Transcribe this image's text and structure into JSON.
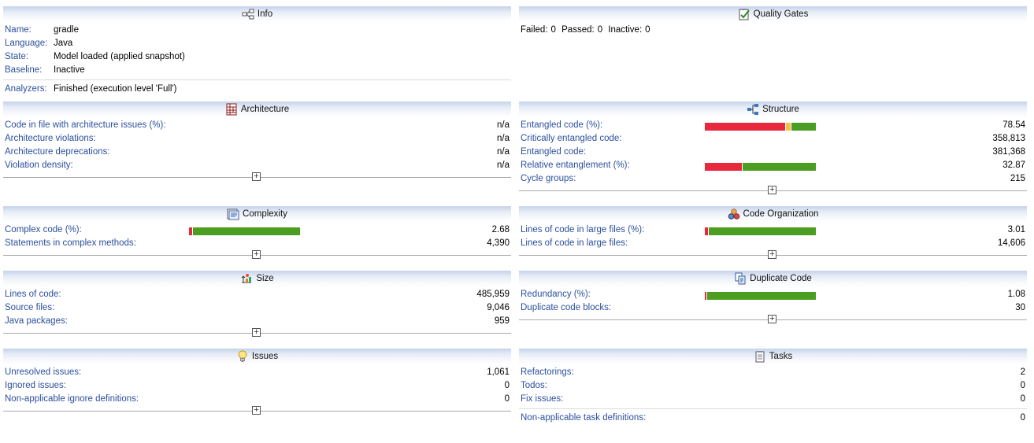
{
  "info": {
    "title": "Info",
    "icon": "info-diagram-icon",
    "rows": [
      {
        "label": "Name:",
        "value": "gradle"
      },
      {
        "label": "Language:",
        "value": "Java"
      },
      {
        "label": "State:",
        "value": "Model loaded (applied snapshot)"
      },
      {
        "label": "Baseline:",
        "value": "Inactive"
      }
    ],
    "analyzers": {
      "label": "Analyzers:",
      "value": "Finished (execution level 'Full')"
    }
  },
  "quality_gates": {
    "title": "Quality Gates",
    "icon": "checklist-icon",
    "failed_label": "Failed:",
    "failed": "0",
    "passed_label": "Passed:",
    "passed": "0",
    "inactive_label": "Inactive:",
    "inactive": "0"
  },
  "architecture": {
    "title": "Architecture",
    "icon": "architecture-icon",
    "rows": [
      {
        "label": "Code in file with architecture issues (%):",
        "value": "n/a"
      },
      {
        "label": "Architecture violations:",
        "value": "n/a"
      },
      {
        "label": "Architecture deprecations:",
        "value": "n/a"
      },
      {
        "label": "Violation density:",
        "value": "n/a"
      }
    ]
  },
  "structure": {
    "title": "Structure",
    "icon": "structure-icon",
    "rows": [
      {
        "label": "Entangled code (%):",
        "value": "78.54",
        "bar": {
          "red": 0.73,
          "yellow": 0.05,
          "green": 0.22
        }
      },
      {
        "label": "Critically entangled code:",
        "value": "358,813"
      },
      {
        "label": "Entangled code:",
        "value": "381,368"
      },
      {
        "label": "Relative entanglement (%):",
        "value": "32.87",
        "bar": {
          "red": 0.33,
          "yellow": 0,
          "green": 0.67
        }
      },
      {
        "label": "Cycle groups:",
        "value": "215"
      }
    ]
  },
  "complexity": {
    "title": "Complexity",
    "icon": "complexity-icon",
    "rows": [
      {
        "label": "Complex code (%):",
        "value": "2.68",
        "bar": {
          "red": 0.027,
          "yellow": 0,
          "green": 0.973
        }
      },
      {
        "label": "Statements in complex methods:",
        "value": "4,390"
      }
    ]
  },
  "code_organization": {
    "title": "Code Organization",
    "icon": "code-organization-icon",
    "rows": [
      {
        "label": "Lines of code in large files (%):",
        "value": "3.01",
        "bar": {
          "red": 0.03,
          "yellow": 0,
          "green": 0.97
        }
      },
      {
        "label": "Lines of code in large files:",
        "value": "14,606"
      }
    ]
  },
  "size": {
    "title": "Size",
    "icon": "size-icon",
    "rows": [
      {
        "label": "Lines of code:",
        "value": "485,959"
      },
      {
        "label": "Source files:",
        "value": "9,046"
      },
      {
        "label": "Java packages:",
        "value": "959"
      }
    ]
  },
  "duplicate_code": {
    "title": "Duplicate Code",
    "icon": "duplicate-code-icon",
    "rows": [
      {
        "label": "Redundancy (%):",
        "value": "1.08",
        "bar": {
          "red": 0.011,
          "yellow": 0,
          "green": 0.989
        }
      },
      {
        "label": "Duplicate code blocks:",
        "value": "30"
      }
    ]
  },
  "issues": {
    "title": "Issues",
    "icon": "lightbulb-icon",
    "rows": [
      {
        "label": "Unresolved issues:",
        "value": "1,061"
      },
      {
        "label": "Ignored issues:",
        "value": "0"
      },
      {
        "label": "Non-applicable ignore definitions:",
        "value": "0"
      }
    ]
  },
  "tasks": {
    "title": "Tasks",
    "icon": "tasks-icon",
    "rows": [
      {
        "label": "Refactorings:",
        "value": "2"
      },
      {
        "label": "Todos:",
        "value": "0"
      },
      {
        "label": "Fix issues:",
        "value": "0"
      }
    ],
    "nonapplicable": {
      "label": "Non-applicable task definitions:",
      "value": "0"
    }
  },
  "colors": {
    "label": "#2b4f9e",
    "bar_red": "#e8283c",
    "bar_yellow": "#f5c043",
    "bar_green": "#4c9e23"
  }
}
